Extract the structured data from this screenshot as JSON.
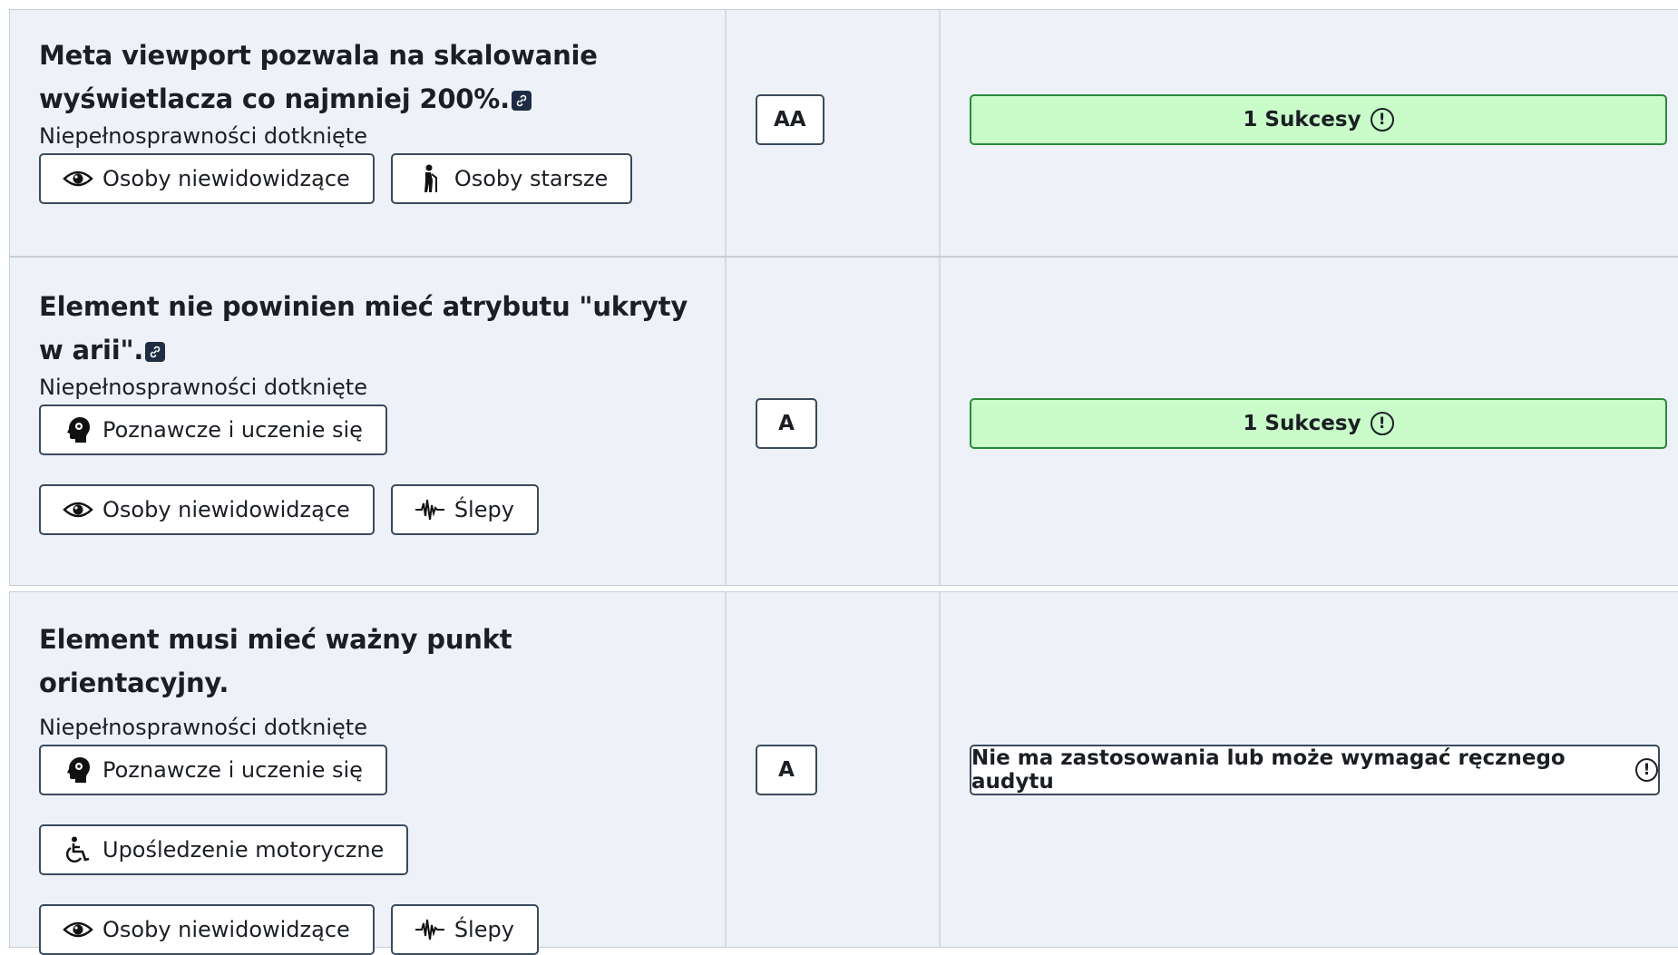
{
  "rows": [
    {
      "title": "Meta viewport pozwala na skalowanie wyświetlacza co najmniej 200%.",
      "affected_label": "Niepełnosprawności dotknięte",
      "chips": [
        {
          "label": "Osoby niewidowidzące",
          "icon": "eye-icon"
        },
        {
          "label": "Osoby starsze",
          "icon": "elderly-person-icon"
        }
      ],
      "level": "AA",
      "status": {
        "type": "success",
        "label": "1 Sukcesy",
        "color": "#c9fcc9"
      }
    },
    {
      "title": "Element nie powinien mieć atrybutu \"ukryty w arii\".",
      "affected_label": "Niepełnosprawności dotknięte",
      "chips": [
        {
          "label": "Poznawcze i uczenie się",
          "icon": "brain-head-icon"
        },
        {
          "label": "Osoby niewidowidzące",
          "icon": "eye-icon"
        },
        {
          "label": "Ślepy",
          "icon": "soundwave-icon"
        }
      ],
      "level": "A",
      "status": {
        "type": "success",
        "label": "1 Sukcesy",
        "color": "#c9fcc9"
      }
    },
    {
      "title": "Element musi mieć ważny punkt orientacyjny.",
      "affected_label": "Niepełnosprawności dotknięte",
      "chips": [
        {
          "label": "Poznawcze i uczenie się",
          "icon": "brain-head-icon"
        },
        {
          "label": "Upośledzenie motoryczne",
          "icon": "wheelchair-icon"
        },
        {
          "label": "Osoby niewidowidzące",
          "icon": "eye-icon"
        },
        {
          "label": "Ślepy",
          "icon": "soundwave-icon"
        }
      ],
      "level": "A",
      "status": {
        "type": "na",
        "label": "Nie ma zastosowania lub może wymagać ręcznego audytu",
        "color": "#ffffff"
      }
    }
  ]
}
